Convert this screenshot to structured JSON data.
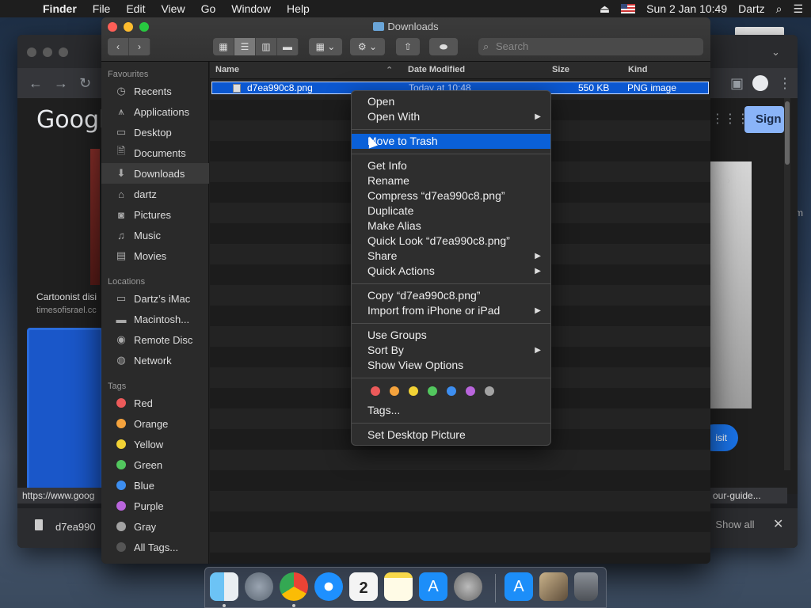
{
  "menubar": {
    "app": "Finder",
    "items": [
      "File",
      "Edit",
      "View",
      "Go",
      "Window",
      "Help"
    ],
    "clock": "Sun 2 Jan  10:49",
    "user": "Dartz"
  },
  "chrome": {
    "logo": "Googl",
    "caption": "Cartoonist disi",
    "source": "timesofisrael.cc",
    "sign_in": "Sign",
    "visit": "isit",
    "status_url": "https://www.goog",
    "status_right": "our-guide...",
    "download_file": "d7ea990",
    "show_all": "Show all"
  },
  "finder": {
    "window_title": "Downloads",
    "search_placeholder": "Search",
    "sidebar": {
      "favourites_header": "Favourites",
      "favourites": [
        "Recents",
        "Applications",
        "Desktop",
        "Documents",
        "Downloads",
        "dartz",
        "Pictures",
        "Music",
        "Movies"
      ],
      "locations_header": "Locations",
      "locations": [
        "Dartz’s iMac",
        "Macintosh...",
        "Remote Disc",
        "Network"
      ],
      "tags_header": "Tags",
      "tags": [
        {
          "label": "Red",
          "color": "#ec5a5a"
        },
        {
          "label": "Orange",
          "color": "#f5a33d"
        },
        {
          "label": "Yellow",
          "color": "#f2d235"
        },
        {
          "label": "Green",
          "color": "#52c75e"
        },
        {
          "label": "Blue",
          "color": "#3d8ef0"
        },
        {
          "label": "Purple",
          "color": "#b965dc"
        },
        {
          "label": "Gray",
          "color": "#a3a3a3"
        },
        {
          "label": "All Tags...",
          "color": "#555555"
        }
      ]
    },
    "columns": {
      "name": "Name",
      "date": "Date Modified",
      "size": "Size",
      "kind": "Kind"
    },
    "file": {
      "name": "d7ea990c8.png",
      "date": "Today at 10:48",
      "size": "550 KB",
      "kind": "PNG image"
    }
  },
  "context_menu": {
    "open": "Open",
    "open_with": "Open With",
    "move_to_trash": "Move to Trash",
    "get_info": "Get Info",
    "rename": "Rename",
    "compress": "Compress “d7ea990c8.png”",
    "duplicate": "Duplicate",
    "make_alias": "Make Alias",
    "quick_look": "Quick Look “d7ea990c8.png”",
    "share": "Share",
    "quick_actions": "Quick Actions",
    "copy": "Copy “d7ea990c8.png”",
    "import_iphone": "Import from iPhone or iPad",
    "use_groups": "Use Groups",
    "sort_by": "Sort By",
    "show_view_options": "Show View Options",
    "tag_colors": [
      "#ec5a5a",
      "#f5a33d",
      "#f2d235",
      "#52c75e",
      "#3d8ef0",
      "#b965dc",
      "#a3a3a3"
    ],
    "tags": "Tags...",
    "set_desktop_picture": "Set Desktop Picture"
  },
  "desktop": {
    "right_label": "m"
  }
}
